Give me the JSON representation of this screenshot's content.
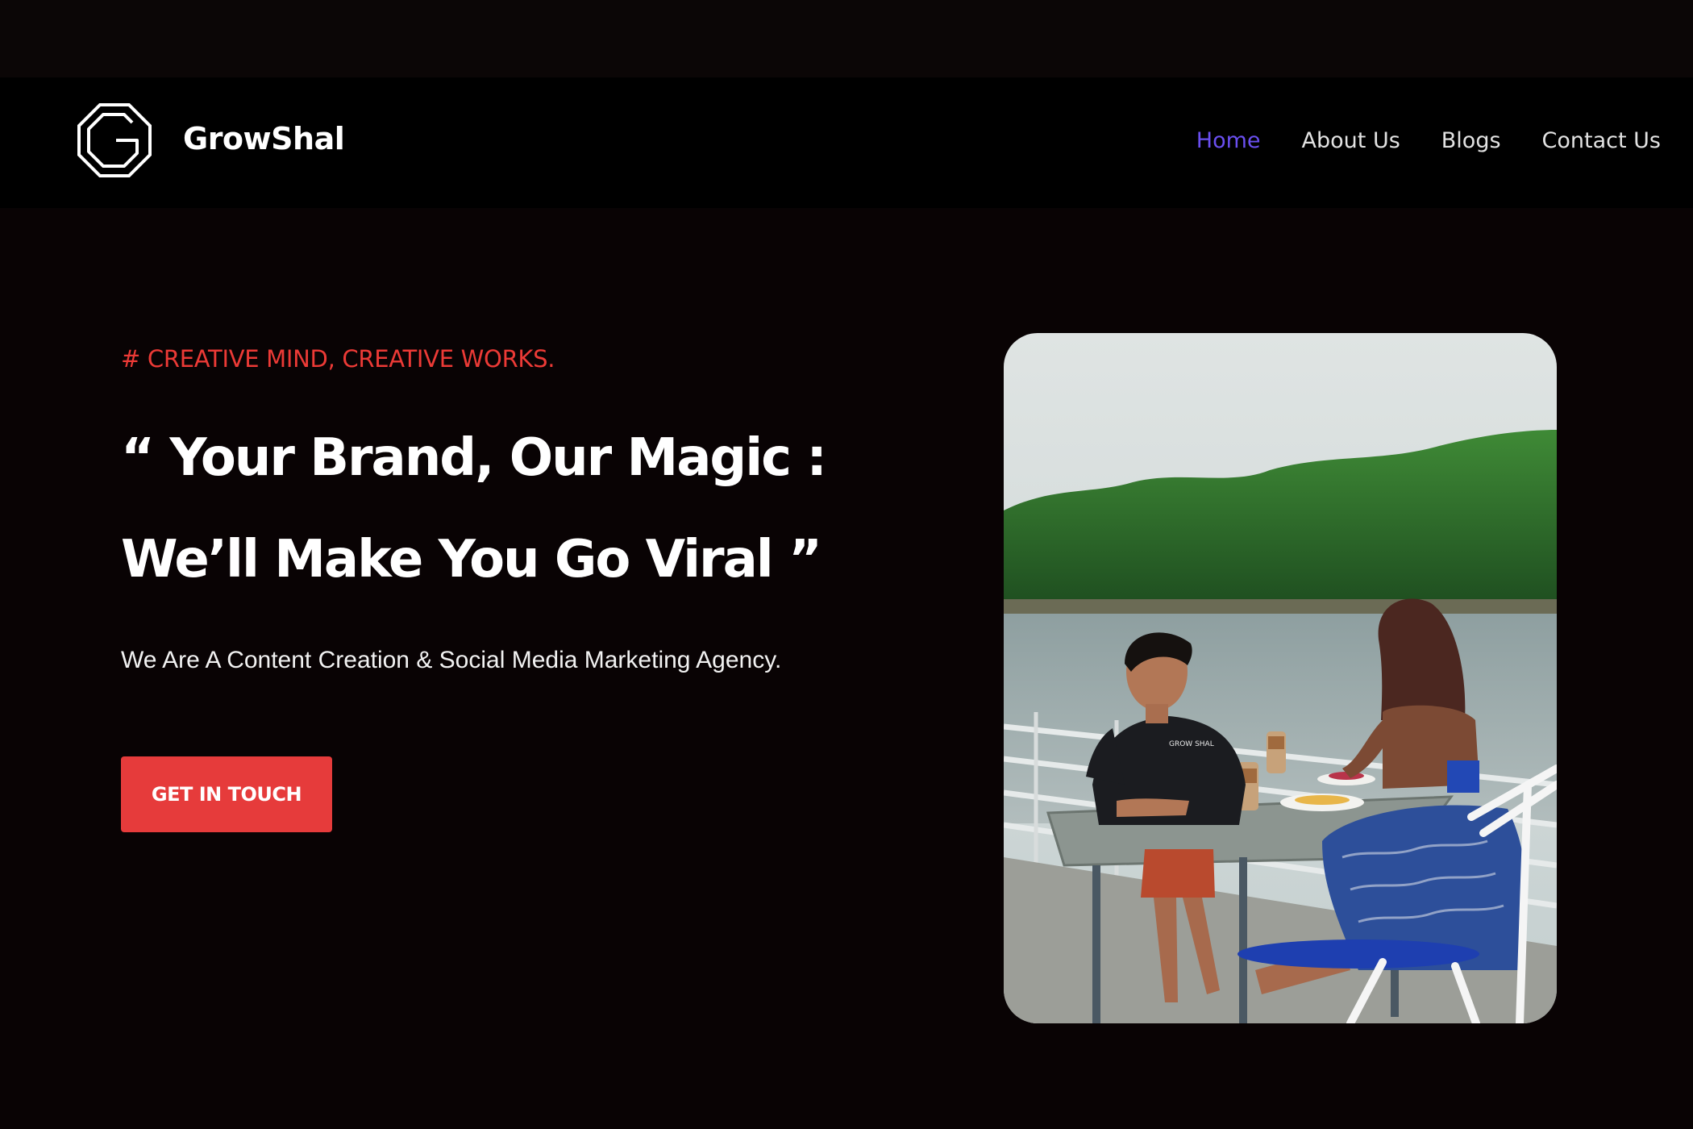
{
  "colors": {
    "background": "#090304",
    "navbar": "#000000",
    "accent_red": "#e63b3b",
    "tagline_red": "#ec3a36",
    "nav_active": "#6a4ff0"
  },
  "header": {
    "logo_icon": "octagon-g-logo-icon",
    "brand_name": "GrowShal",
    "nav": [
      {
        "label": "Home",
        "active": true
      },
      {
        "label": "About Us",
        "active": false
      },
      {
        "label": "Blogs",
        "active": false
      },
      {
        "label": "Contact Us",
        "active": false
      }
    ]
  },
  "hero": {
    "tagline": "# CREATIVE MIND, CREATIVE WORKS.",
    "headline_line1": "“ Your Brand, Our Magic :",
    "headline_line2": "We’ll Make You Go Viral ”",
    "subtext": "We Are A Content Creation & Social Media Marketing Agency.",
    "cta_label": "GET IN TOUCH"
  },
  "image": {
    "logo_on_shirt": "GROW SHAL"
  }
}
